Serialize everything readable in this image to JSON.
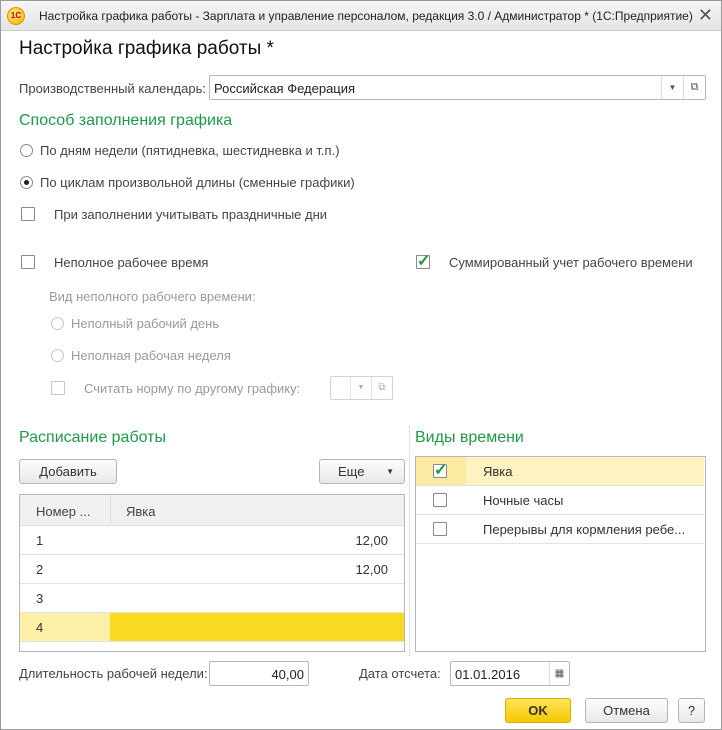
{
  "window": {
    "title": "Настройка графика работы - Зарплата и управление персоналом, редакция 3.0 / Администратор *  (1С:Предприятие)",
    "logo": "1C",
    "close": "✕"
  },
  "heading": "Настройка графика работы *",
  "calendar": {
    "label": "Производственный календарь:",
    "value": "Российская Федерация"
  },
  "fill_method": {
    "title": "Способ заполнения графика",
    "options": [
      "По дням недели (пятидневка, шестидневка и т.п.)",
      "По циклам произвольной длины (сменные графики)"
    ],
    "selected": 1,
    "holidays_label": "При заполнении учитывать праздничные дни",
    "holidays_checked": false
  },
  "part_time": {
    "label": "Неполное рабочее время",
    "checked": false,
    "kind_label": "Вид неполного рабочего времени:",
    "options": [
      "Неполный рабочий день",
      "Неполная рабочая неделя"
    ],
    "other_norm_label": "Считать норму по другому графику:"
  },
  "summarized": {
    "label": "Суммированный учет рабочего времени",
    "checked": true
  },
  "schedule": {
    "title": "Расписание работы",
    "add": "Добавить",
    "more": "Еще",
    "columns": [
      "Номер ...",
      "Явка"
    ],
    "rows": [
      {
        "n": "1",
        "v": "12,00"
      },
      {
        "n": "2",
        "v": "12,00"
      },
      {
        "n": "3",
        "v": ""
      },
      {
        "n": "4",
        "v": ""
      }
    ]
  },
  "time_types": {
    "title": "Виды времени",
    "items": [
      {
        "label": "Явка",
        "checked": true
      },
      {
        "label": "Ночные часы",
        "checked": false
      },
      {
        "label": "Перерывы для кормления ребе...",
        "checked": false
      }
    ]
  },
  "week_length": {
    "label": "Длительность рабочей недели:",
    "value": "40,00"
  },
  "start_date": {
    "label": "Дата отсчета:",
    "value": "01.01.2016"
  },
  "buttons": {
    "ok": "OK",
    "cancel": "Отмена",
    "help": "?"
  },
  "colors": {
    "accent": "#1f9a4a",
    "selection": "#fada21",
    "selection_light": "#fbf0a6"
  }
}
